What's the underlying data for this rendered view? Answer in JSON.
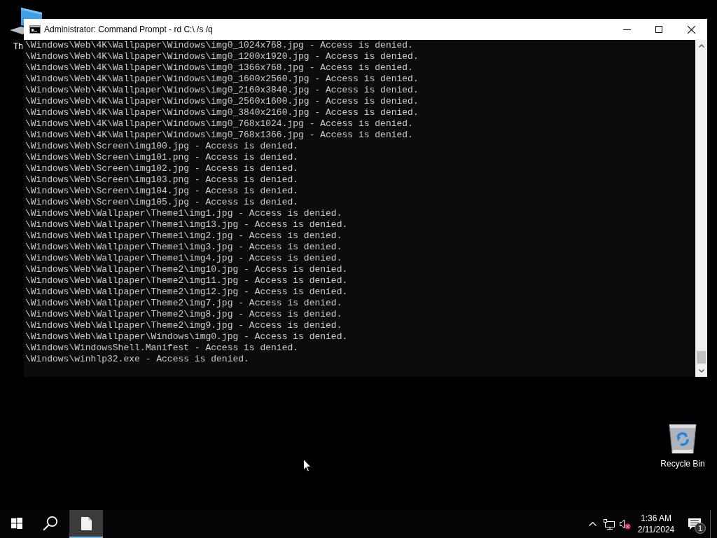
{
  "desktop": {
    "icons": [
      {
        "kind": "computer",
        "label": "Th"
      },
      {
        "kind": "recycle-bin",
        "label": "Recycle Bin"
      }
    ]
  },
  "window": {
    "title": "Administrator: Command Prompt - rd C:\\ /s /q",
    "lines": [
      "\\Windows\\Web\\4K\\Wallpaper\\Windows\\img0_1024x768.jpg - Access is denied.",
      "\\Windows\\Web\\4K\\Wallpaper\\Windows\\img0_1200x1920.jpg - Access is denied.",
      "\\Windows\\Web\\4K\\Wallpaper\\Windows\\img0_1366x768.jpg - Access is denied.",
      "\\Windows\\Web\\4K\\Wallpaper\\Windows\\img0_1600x2560.jpg - Access is denied.",
      "\\Windows\\Web\\4K\\Wallpaper\\Windows\\img0_2160x3840.jpg - Access is denied.",
      "\\Windows\\Web\\4K\\Wallpaper\\Windows\\img0_2560x1600.jpg - Access is denied.",
      "\\Windows\\Web\\4K\\Wallpaper\\Windows\\img0_3840x2160.jpg - Access is denied.",
      "\\Windows\\Web\\4K\\Wallpaper\\Windows\\img0_768x1024.jpg - Access is denied.",
      "\\Windows\\Web\\4K\\Wallpaper\\Windows\\img0_768x1366.jpg - Access is denied.",
      "\\Windows\\Web\\Screen\\img100.jpg - Access is denied.",
      "\\Windows\\Web\\Screen\\img101.png - Access is denied.",
      "\\Windows\\Web\\Screen\\img102.jpg - Access is denied.",
      "\\Windows\\Web\\Screen\\img103.png - Access is denied.",
      "\\Windows\\Web\\Screen\\img104.jpg - Access is denied.",
      "\\Windows\\Web\\Screen\\img105.jpg - Access is denied.",
      "\\Windows\\Web\\Wallpaper\\Theme1\\img1.jpg - Access is denied.",
      "\\Windows\\Web\\Wallpaper\\Theme1\\img13.jpg - Access is denied.",
      "\\Windows\\Web\\Wallpaper\\Theme1\\img2.jpg - Access is denied.",
      "\\Windows\\Web\\Wallpaper\\Theme1\\img3.jpg - Access is denied.",
      "\\Windows\\Web\\Wallpaper\\Theme1\\img4.jpg - Access is denied.",
      "\\Windows\\Web\\Wallpaper\\Theme2\\img10.jpg - Access is denied.",
      "\\Windows\\Web\\Wallpaper\\Theme2\\img11.jpg - Access is denied.",
      "\\Windows\\Web\\Wallpaper\\Theme2\\img12.jpg - Access is denied.",
      "\\Windows\\Web\\Wallpaper\\Theme2\\img7.jpg - Access is denied.",
      "\\Windows\\Web\\Wallpaper\\Theme2\\img8.jpg - Access is denied.",
      "\\Windows\\Web\\Wallpaper\\Theme2\\img9.jpg - Access is denied.",
      "\\Windows\\Web\\Wallpaper\\Windows\\img0.jpg - Access is denied.",
      "\\Windows\\WindowsShell.Manifest - Access is denied.",
      "\\Windows\\winhlp32.exe - Access is denied."
    ]
  },
  "taskbar": {
    "buttons": [
      {
        "kind": "start",
        "active": false
      },
      {
        "kind": "search",
        "active": false
      },
      {
        "kind": "app",
        "active": true
      }
    ],
    "volume": {
      "muted": true
    },
    "clock": {
      "time": "1:36 AM",
      "date": "2/11/2024"
    },
    "notifications": {
      "count": "1"
    }
  }
}
